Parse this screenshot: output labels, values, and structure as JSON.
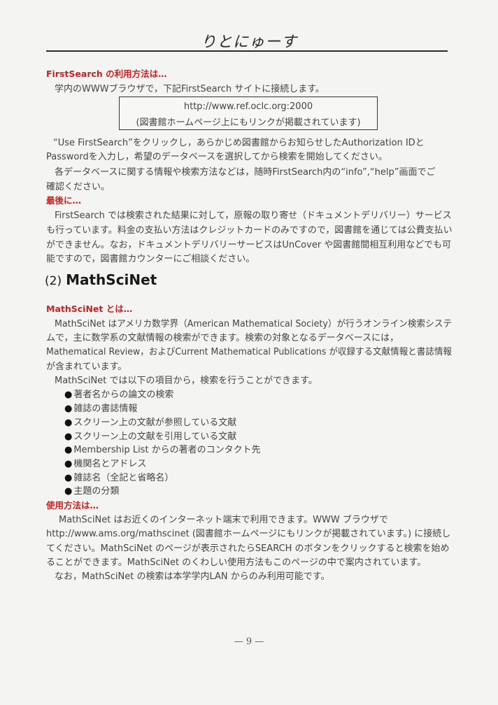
{
  "header": {
    "title": "りとにゅーす"
  },
  "firstsearch": {
    "heading": "FirstSearch の利用方法は…",
    "intro": "学内のWWWブラウザで，下記FirstSearch サイトに接続します。",
    "box_url": "http://www.ref.oclc.org:2000",
    "box_note": "(図書館ホームページ上にもリンクが掲載されています)",
    "para1": [
      "“Use FirstSearch”をクリックし，あらかじめ図書館からお知らせしたAuthorization IDと",
      "Passwordを入力し，希望のデータベースを選択してから検索を開始してください。"
    ],
    "para2": [
      "各データベースに関する情報や検索方法などは，随時FirstSearch内の“info”,“help”画面でご",
      "確認ください。"
    ],
    "last_heading": "最後に…",
    "para3": [
      "FirstSearch では検索された結果に対して，原報の取り寄せ（ドキュメントデリバリー）サービス",
      "も行っています。料金の支払い方法はクレジットカードのみですので，図書館を通じては公費支払い",
      "ができません。なお，ドキュメントデリバリーサービスはUnCover や図書館間相互利用などでも可",
      "能ですので，図書館カウンターにご相談ください。"
    ]
  },
  "mathscinet": {
    "section_number": "(2)",
    "section_title": "MathSciNet",
    "about_heading": "MathSciNet とは…",
    "para1": [
      "MathSciNet はアメリカ数学界（American Mathematical Society）が行うオンライン検索システ",
      "ムで，主に数学系の文献情報の検索ができます。検索の対象となるデータベースには，",
      "Mathematical Review，およびCurrent Mathematical Publications が収録する文献情報と書誌情報",
      "が含まれています。"
    ],
    "para2": "MathSciNet では以下の項目から，検索を行うことができます。",
    "items": [
      "著者名からの論文の検索",
      "雑誌の書誌情報",
      "スクリーン上の文献が参照している文献",
      "スクリーン上の文献を引用している文献",
      "Membership List からの著者のコンタクト先",
      "機関名とアドレス",
      "雑誌名（全記と省略名）",
      "主題の分類"
    ],
    "usage_heading": "使用方法は…",
    "para3": [
      "MathSciNet はお近くのインターネット端末で利用できます。WWW ブラウザで",
      "http://www.ams.org/mathscinet (図書館ホームページにもリンクが掲載されています。) に接続し",
      "てください。MathSciNet のページが表示されたらSEARCH のボタンをクリックすると検索を始め",
      "ることができます。MathSciNet のくわしい使用方法もこのページの中で案内されています。"
    ],
    "para4": "なお，MathSciNet の検索は本学学内LAN からのみ利用可能です。"
  },
  "footer": {
    "page_number": "— 9 —"
  }
}
